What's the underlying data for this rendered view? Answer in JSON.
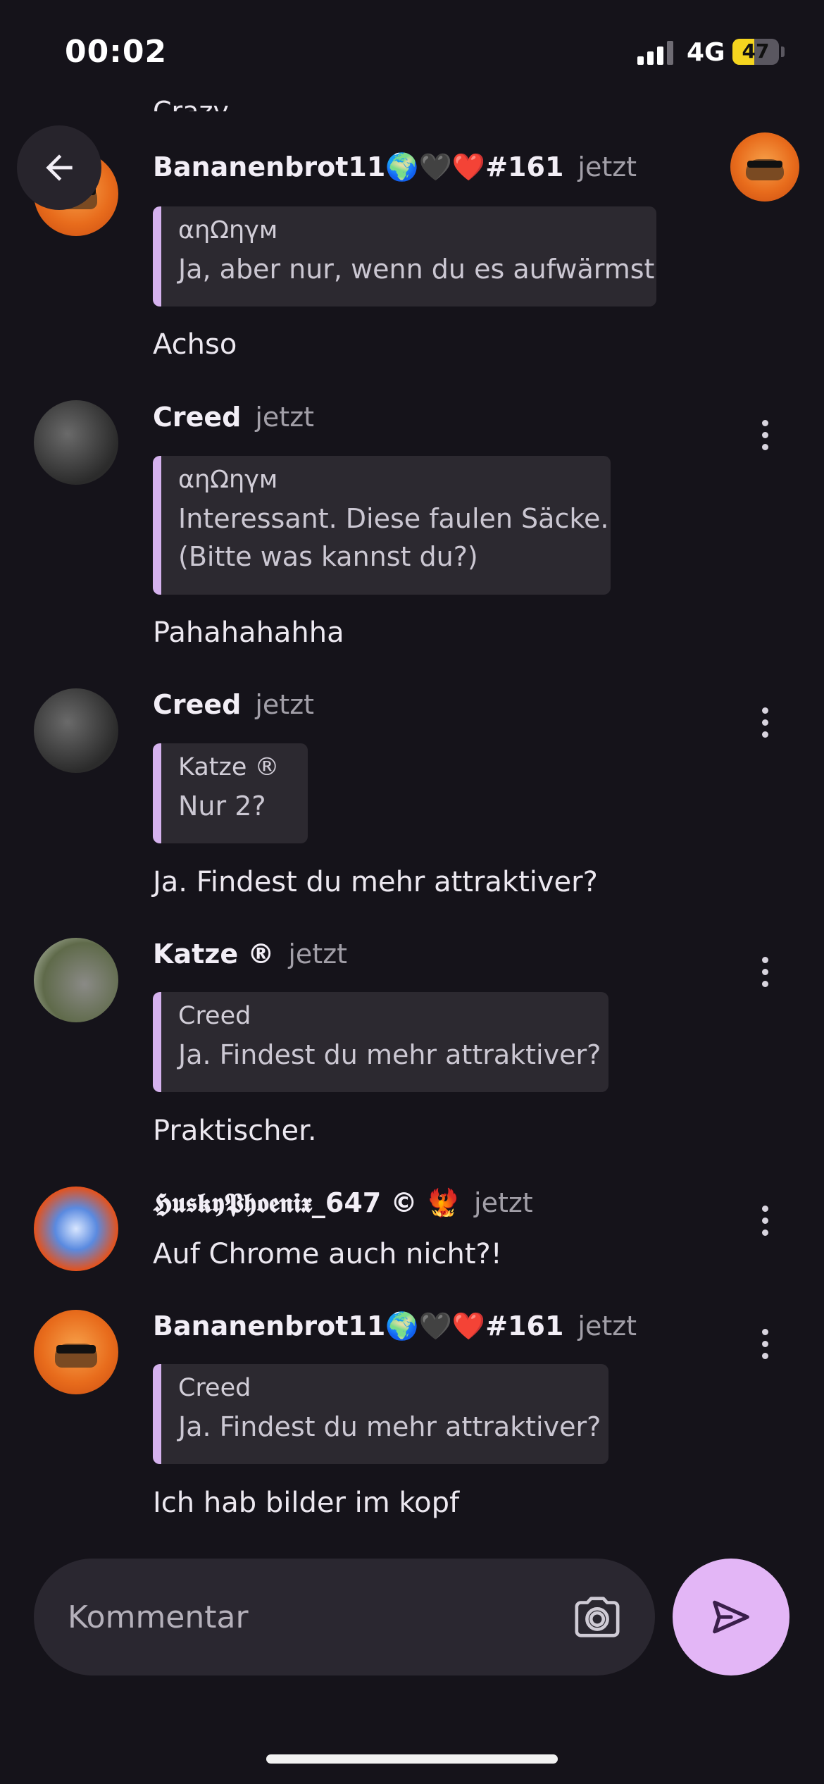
{
  "status_bar": {
    "time": "00:02",
    "network": "4G",
    "battery": "47",
    "battery_fraction": 0.47
  },
  "top_clipped_message": "Crazy",
  "comments": [
    {
      "author": "Bananenbrot11🌍🖤❤️#161",
      "time": "jetzt",
      "quote": {
        "author": "αηΩηγм",
        "lines": [
          "Ja, aber nur, wenn du es aufwärmst"
        ]
      },
      "text": "Achso"
    },
    {
      "author": "Creed",
      "time": "jetzt",
      "quote": {
        "author": "αηΩηγм",
        "lines": [
          "Interessant. Diese faulen Säcke.",
          "(Bitte was kannst du?)"
        ]
      },
      "text": "Pahahahahha"
    },
    {
      "author": "Creed",
      "time": "jetzt",
      "quote": {
        "author": "Katze ®",
        "lines": [
          "Nur 2?"
        ]
      },
      "text": "Ja. Findest du mehr attraktiver?"
    },
    {
      "author": "Katze ®",
      "time": "jetzt",
      "quote": {
        "author": "Creed",
        "lines": [
          "Ja. Findest du mehr attraktiver?"
        ]
      },
      "text": "Praktischer."
    },
    {
      "author": "𝕳𝖚𝖘𝖐𝖞𝕻𝖍𝖔𝖊𝖓𝖎𝖝_647 © 🐦‍🔥",
      "time": "jetzt",
      "quote": null,
      "text": "Auf Chrome auch nicht?!"
    },
    {
      "author": "Bananenbrot11🌍🖤❤️#161",
      "time": "jetzt",
      "quote": {
        "author": "Creed",
        "lines": [
          "Ja. Findest du mehr attraktiver?"
        ]
      },
      "text": "Ich hab bilder im kopf"
    }
  ],
  "composer": {
    "placeholder": "Kommentar"
  },
  "icons": {
    "back": "arrow-left-icon",
    "menu": "more-vertical-icon",
    "camera": "camera-icon",
    "send": "send-icon"
  },
  "colors": {
    "background": "#15131a",
    "quote_accent": "#d5b2ee",
    "send_button": "#e3b6f6",
    "battery_fill": "#f5d51f"
  }
}
